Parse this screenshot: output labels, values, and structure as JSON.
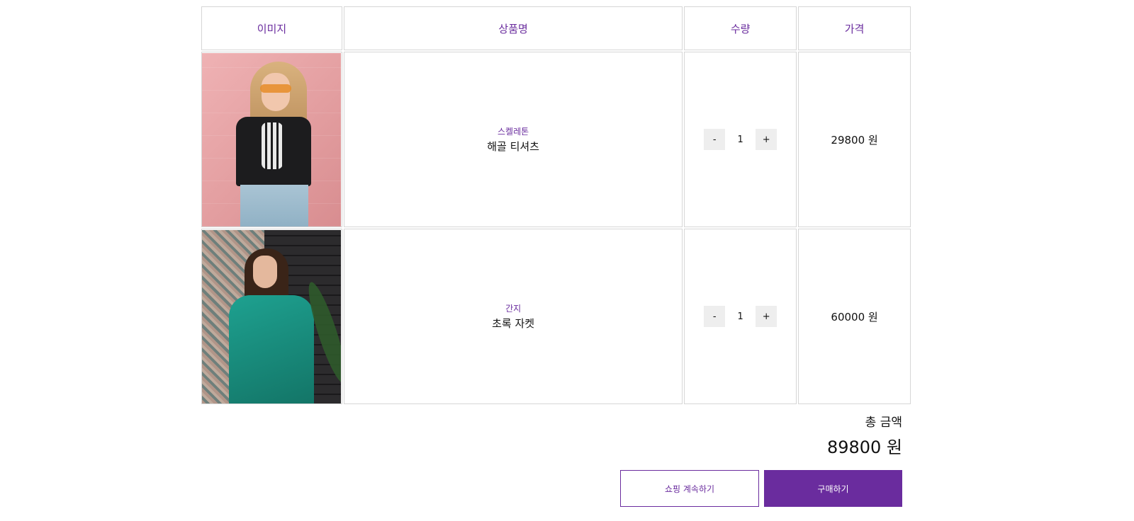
{
  "cart": {
    "headers": {
      "image": "이미지",
      "name": "상품명",
      "qty": "수량",
      "price": "가격"
    },
    "items": [
      {
        "image_icon": "woman-black-tshirt-photo",
        "brand": "스켈레톤",
        "name": "해골 티셔츠",
        "qty": "1",
        "price": "29800 원"
      },
      {
        "image_icon": "woman-green-jacket-photo",
        "brand": "간지",
        "name": "초록 자켓",
        "qty": "1",
        "price": "60000 원"
      }
    ],
    "qty_minus": "-",
    "qty_plus": "+"
  },
  "summary": {
    "total_label": "총 금액",
    "total_value": "89800 원"
  },
  "actions": {
    "continue_label": "쇼핑 계속하기",
    "buy_label": "구매하기"
  },
  "colors": {
    "accent": "#6a2c9e",
    "border": "#d6d6d6",
    "qty_button_bg": "#eeeeee"
  }
}
